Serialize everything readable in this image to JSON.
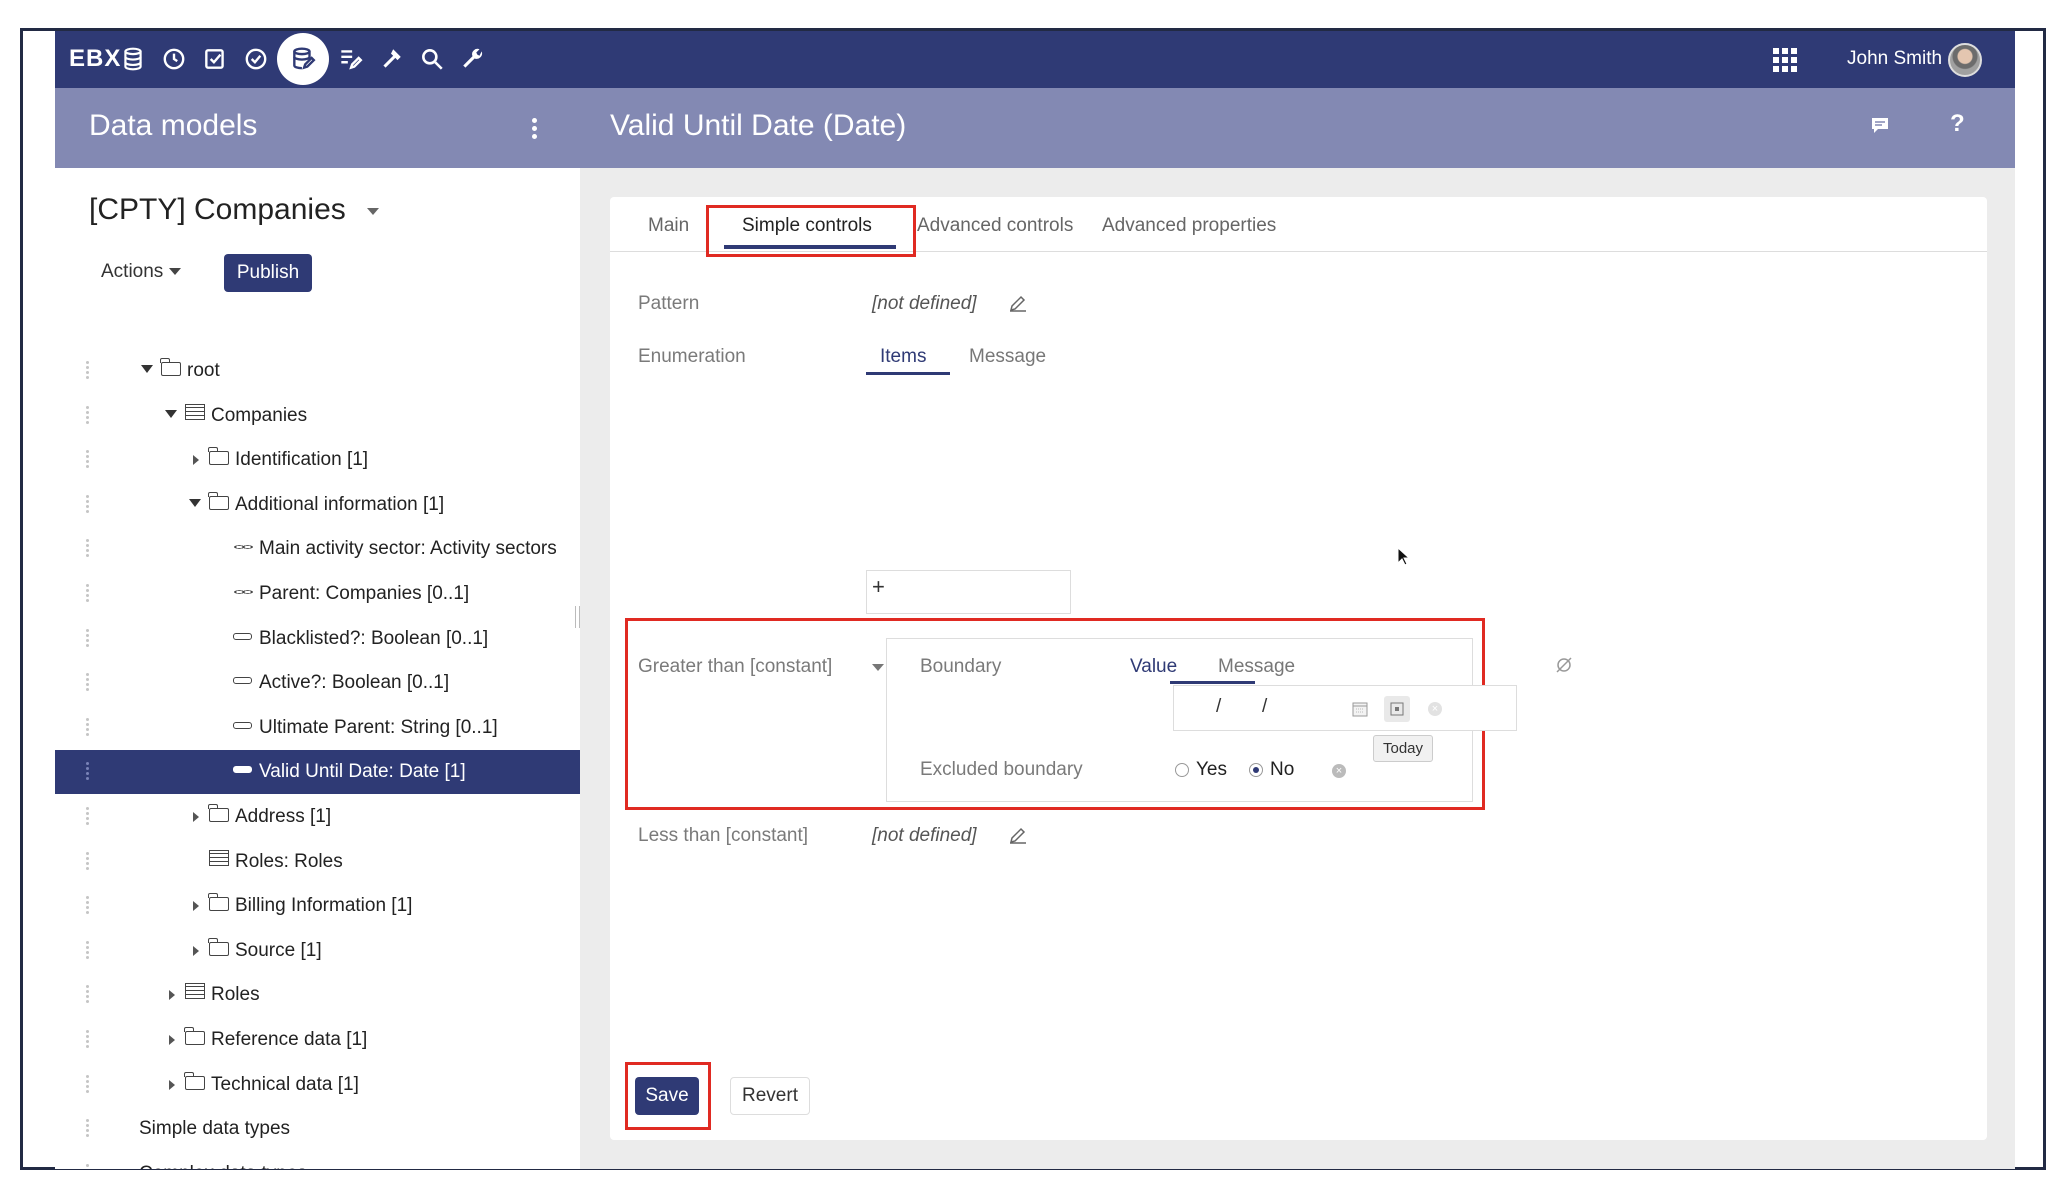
{
  "topbar": {
    "brand": "EBX",
    "icons": [
      "database-icon",
      "history-icon",
      "tasks-icon",
      "check-circle-icon",
      "data-model-icon",
      "workflow-icon",
      "tools-icon",
      "search-icon",
      "wrench-icon"
    ],
    "active_icon": "data-model-icon",
    "user_name": "John Smith",
    "accent_color": "#2f3a75"
  },
  "subheader": {
    "left_title": "Data models",
    "right_title": "Valid Until Date (Date)",
    "help_label": "?"
  },
  "model": {
    "title": "[CPTY] Companies",
    "actions_label": "Actions",
    "publish_label": "Publish"
  },
  "tree": [
    {
      "label": "root",
      "icon": "folder",
      "toggle": "open"
    },
    {
      "label": "Companies",
      "icon": "table",
      "toggle": "open"
    },
    {
      "label": "Identification [1]",
      "icon": "folder",
      "toggle": "closed"
    },
    {
      "label": "Additional information [1]",
      "icon": "folder",
      "toggle": "open"
    },
    {
      "label": "Main activity sector: Activity sectors",
      "icon": "link",
      "toggle": "none"
    },
    {
      "label": "Parent: Companies  [0..1]",
      "icon": "link",
      "toggle": "none"
    },
    {
      "label": "Blacklisted?: Boolean  [0..1]",
      "icon": "field",
      "toggle": "none"
    },
    {
      "label": "Active?: Boolean  [0..1]",
      "icon": "field",
      "toggle": "none"
    },
    {
      "label": "Ultimate Parent: String  [0..1]",
      "icon": "field",
      "toggle": "none"
    },
    {
      "label": "Valid Until Date: Date  [1]",
      "icon": "field",
      "toggle": "none",
      "selected": true
    },
    {
      "label": "Address [1]",
      "icon": "folder",
      "toggle": "closed"
    },
    {
      "label": "Roles: Roles",
      "icon": "table",
      "toggle": "none"
    },
    {
      "label": "Billing Information [1]",
      "icon": "folder",
      "toggle": "closed"
    },
    {
      "label": "Source [1]",
      "icon": "folder",
      "toggle": "closed"
    },
    {
      "label": "Roles",
      "icon": "table",
      "toggle": "closed"
    },
    {
      "label": "Reference data [1]",
      "icon": "folder",
      "toggle": "closed"
    },
    {
      "label": "Technical data [1]",
      "icon": "folder",
      "toggle": "closed"
    },
    {
      "label": "Simple data types",
      "icon": "none",
      "toggle": "none"
    },
    {
      "label": "Complex data types",
      "icon": "none",
      "toggle": "none"
    }
  ],
  "tabs": [
    "Main",
    "Simple controls",
    "Advanced controls",
    "Advanced properties"
  ],
  "active_tab": "Simple controls",
  "form": {
    "pattern_label": "Pattern",
    "pattern_value": "[not defined]",
    "enumeration_label": "Enumeration",
    "enum_tab_items": "Items",
    "enum_tab_message": "Message",
    "enum_add": "+",
    "greater_label": "Greater than [constant]",
    "boundary_label": "Boundary",
    "boundary_tab_value": "Value",
    "boundary_tab_message": "Message",
    "date_slash_1": "/",
    "date_slash_2": "/",
    "today_tooltip": "Today",
    "excluded_label": "Excluded boundary",
    "yes_label": "Yes",
    "no_label": "No",
    "excluded_value": "No",
    "less_label": "Less than [constant]",
    "less_value": "[not defined]"
  },
  "buttons": {
    "save_label": "Save",
    "revert_label": "Revert"
  },
  "highlight_color": "#e02a22"
}
